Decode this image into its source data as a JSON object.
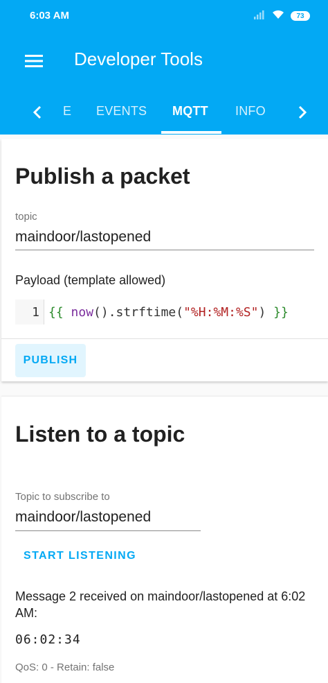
{
  "status_bar": {
    "time": "6:03 AM",
    "battery": "73"
  },
  "toolbar": {
    "title": "Developer Tools"
  },
  "tabs": {
    "items": [
      {
        "label": "E"
      },
      {
        "label": "EVENTS"
      },
      {
        "label": "MQTT"
      },
      {
        "label": "INFO"
      }
    ],
    "active": "MQTT"
  },
  "publish_card": {
    "title": "Publish a packet",
    "topic_label": "topic",
    "topic_value": "maindoor/lastopened",
    "payload_label": "Payload (template allowed)",
    "code": {
      "line_number": "1",
      "open_brace": "{{",
      "fn_name": " now",
      "call": "().strftime(",
      "string": "\"%H:%M:%S\"",
      "close_paren": ")",
      "close_brace": " }}"
    },
    "publish_label": "PUBLISH"
  },
  "listen_card": {
    "title": "Listen to a topic",
    "topic_label": "Topic to subscribe to",
    "topic_value": "maindoor/lastopened",
    "listen_label": "START LISTENING",
    "message_header": "Message 2 received on maindoor/lastopened at 6:02 AM:",
    "message_payload": "06:02:34",
    "message_meta": "QoS: 0 - Retain: false"
  },
  "colors": {
    "primary": "#03a9f4",
    "button_bg": "#e1f5fe"
  }
}
